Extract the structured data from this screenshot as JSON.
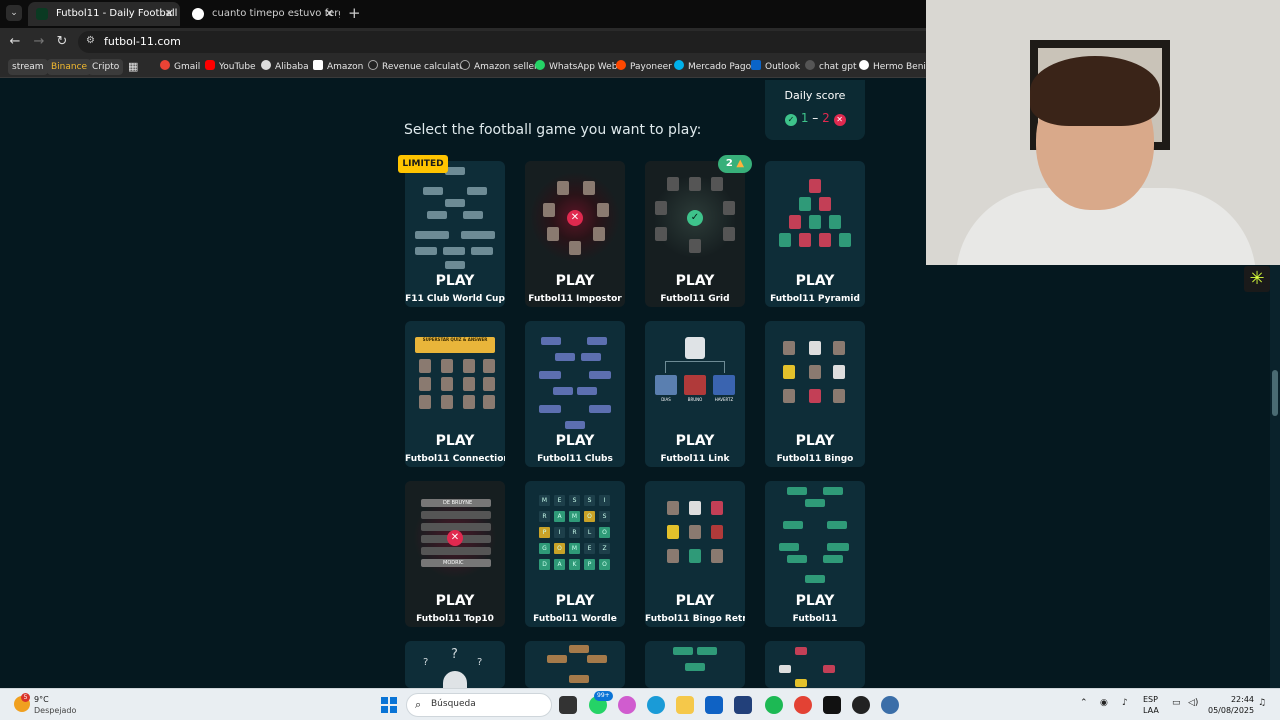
{
  "browser": {
    "tabs": [
      {
        "title": "Futbol11 - Daily Football Game",
        "active": true
      },
      {
        "title": "cuanto timepo estuvo ferguson",
        "active": false
      }
    ],
    "url": "futbol-11.com",
    "bookmarks": [
      {
        "label": "stream",
        "pill": true
      },
      {
        "label": "Binance",
        "pill": true
      },
      {
        "label": "Cripto",
        "pill": true
      },
      {
        "label": "Gmail"
      },
      {
        "label": "YouTube"
      },
      {
        "label": "Alibaba"
      },
      {
        "label": "Amazon"
      },
      {
        "label": "Revenue calculator"
      },
      {
        "label": "Amazon seller"
      },
      {
        "label": "WhatsApp Web"
      },
      {
        "label": "Payoneer"
      },
      {
        "label": "Mercado Pago"
      },
      {
        "label": "Outlook"
      },
      {
        "label": "chat gpt"
      },
      {
        "label": "Hermo Benito"
      }
    ]
  },
  "page": {
    "daily_score": {
      "title": "Daily score",
      "correct": "1",
      "separator": "–",
      "wrong": "2"
    },
    "prompt": "Select the football game you want to play:",
    "play_label": "PLAY",
    "ribbon_limited": "LIMITED",
    "ribbon_streak": "2",
    "games": [
      {
        "name": "F11 Club World Cup"
      },
      {
        "name": "Futbol11 Impostor"
      },
      {
        "name": "Futbol11 Grid"
      },
      {
        "name": "Futbol11 Pyramid"
      },
      {
        "name": "Futbol11 Connections"
      },
      {
        "name": "Futbol11 Clubs"
      },
      {
        "name": "Futbol11 Link"
      },
      {
        "name": "Futbol11 Bingo"
      },
      {
        "name": "Futbol11 Top10"
      },
      {
        "name": "Futbol11 Wordle"
      },
      {
        "name": "Futbol11 Bingo Retro"
      },
      {
        "name": "Futbol11"
      }
    ],
    "link_players": [
      "DIAS",
      "BRUNO",
      "HAVERTZ"
    ],
    "wordle_letters": [
      "M",
      "E",
      "S",
      "S",
      "I",
      "R",
      "A",
      "M",
      "O",
      "S",
      "P",
      "I",
      "R",
      "L",
      "O",
      "G",
      "O",
      "M",
      "E",
      "Z",
      "D",
      "A",
      "K",
      "P",
      "O"
    ],
    "top10_rows": [
      "DE BRUYNE",
      "MODRIC"
    ],
    "connections_banner": "SUPERSTAR QUIZ & ANSWER"
  },
  "taskbar": {
    "weather_temp": "9°C",
    "weather_cond": "Despejado",
    "weather_badge": "5",
    "search_placeholder": "Búsqueda",
    "lang_top": "ESP",
    "lang_bottom": "LAA",
    "time": "22:44",
    "date": "05/08/2025",
    "badge_count": "99+"
  }
}
